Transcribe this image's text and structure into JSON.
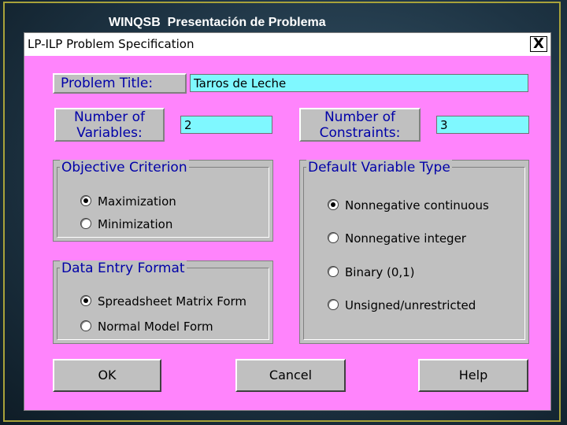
{
  "slide": {
    "title": "WINQSB  Presentación de Problema"
  },
  "dialog": {
    "title": "LP-ILP Problem Specification",
    "close_label": "X",
    "problem_title_label": "Problem Title:",
    "problem_title_value": "Tarros de Leche",
    "num_variables_label_1": "Number of",
    "num_variables_label_2": "Variables:",
    "num_variables_value": "2",
    "num_constraints_label_1": "Number of",
    "num_constraints_label_2": "Constraints:",
    "num_constraints_value": "3",
    "objective": {
      "legend": "Objective Criterion",
      "options": [
        {
          "label": "Maximization",
          "selected": true
        },
        {
          "label": "Minimization",
          "selected": false
        }
      ]
    },
    "data_entry": {
      "legend": "Data Entry Format",
      "options": [
        {
          "label": "Spreadsheet Matrix Form",
          "selected": true
        },
        {
          "label": "Normal Model Form",
          "selected": false
        }
      ]
    },
    "variable_type": {
      "legend": "Default Variable Type",
      "options": [
        {
          "label": "Nonnegative continuous",
          "selected": true
        },
        {
          "label": "Nonnegative integer",
          "selected": false
        },
        {
          "label": "Binary (0,1)",
          "selected": false
        },
        {
          "label": "Unsigned/unrestricted",
          "selected": false
        }
      ]
    },
    "buttons": {
      "ok": "OK",
      "cancel": "Cancel",
      "help": "Help"
    }
  }
}
